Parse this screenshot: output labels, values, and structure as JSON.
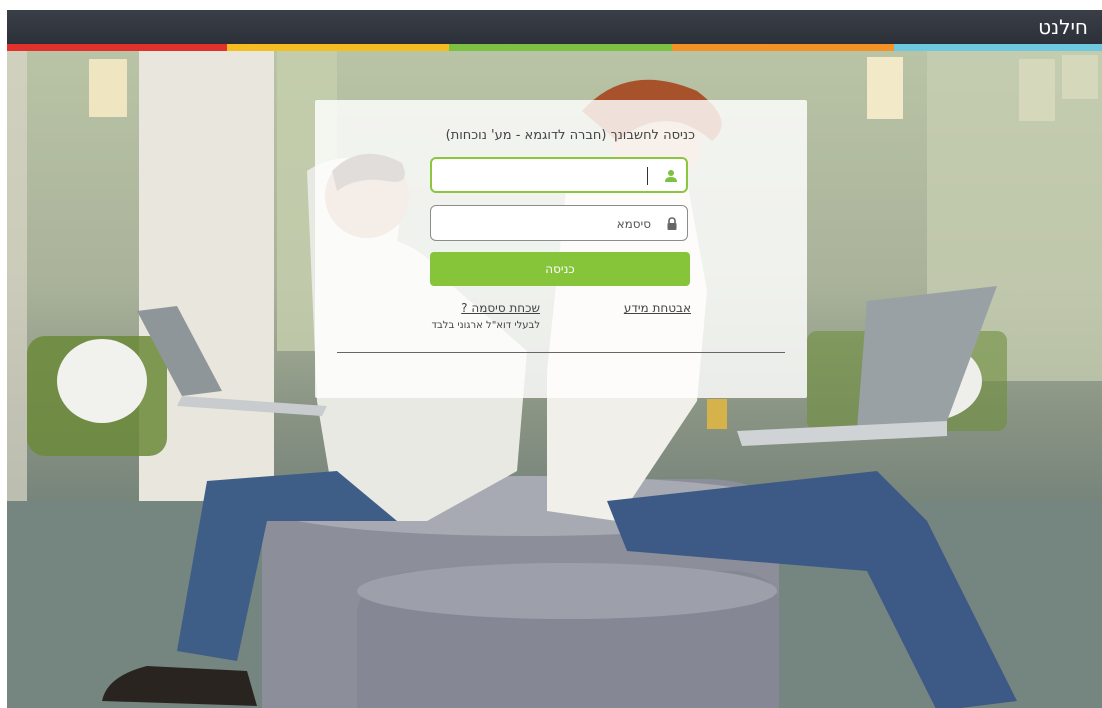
{
  "header": {
    "brand": "חילנט",
    "stripe_colors": [
      "#e0312c",
      "#f5bd1f",
      "#7cc142",
      "#f39325",
      "#6ec9e0"
    ],
    "bar_color": "#2f333b"
  },
  "login": {
    "title": "כניסה לחשבונך (חברה לדוגמא - מע' נוכחות)",
    "username_value": "",
    "username_icon": "user-icon",
    "password_placeholder": "סיסמא",
    "password_icon": "lock-icon",
    "submit_label": "כניסה",
    "accent_color": "#86c53a",
    "security_link": "אבטחת מידע",
    "forgot_link": "שכחת סיסמה ?",
    "forgot_note": "לבעלי דוא\"ל ארגוני בלבד"
  }
}
